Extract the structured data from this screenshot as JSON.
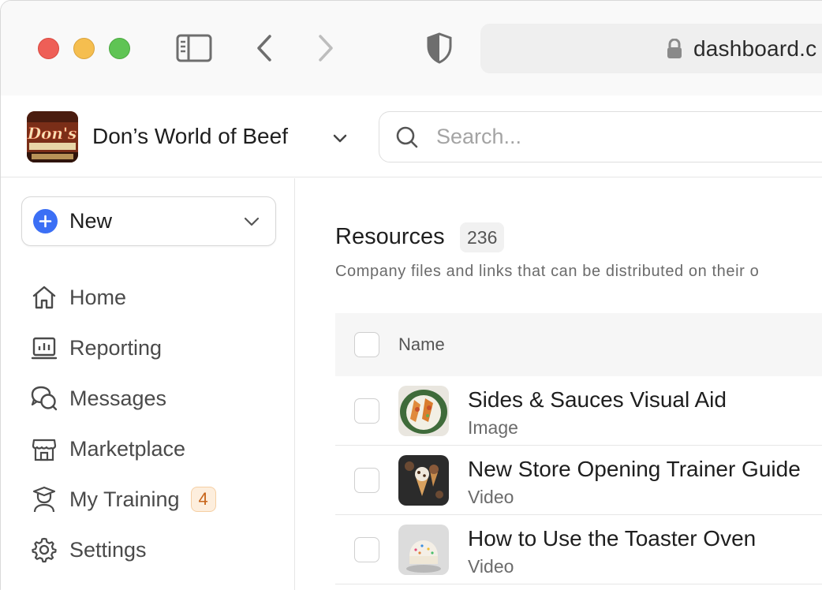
{
  "browser": {
    "url": "dashboard.c",
    "icons": [
      "sidebar-toggle-icon",
      "back-arrow-icon",
      "forward-arrow-icon",
      "shield-icon",
      "lock-icon"
    ]
  },
  "header": {
    "org_name": "Don’s World of Beef",
    "logo_text": "Don's",
    "search_placeholder": "Search..."
  },
  "sidebar": {
    "new_label": "New",
    "items": [
      {
        "label": "Home",
        "icon": "home-icon"
      },
      {
        "label": "Reporting",
        "icon": "reporting-icon"
      },
      {
        "label": "Messages",
        "icon": "messages-icon"
      },
      {
        "label": "Marketplace",
        "icon": "marketplace-icon"
      },
      {
        "label": "My Training",
        "icon": "training-icon",
        "badge": "4"
      },
      {
        "label": "Settings",
        "icon": "gear-icon"
      }
    ]
  },
  "main": {
    "title": "Resources",
    "count": "236",
    "description": "Company files and links that can be distributed on their o",
    "table": {
      "header": "Name",
      "rows": [
        {
          "title": "Sides & Sauces Visual Aid",
          "type": "Image"
        },
        {
          "title": "New Store Opening Trainer Guide",
          "type": "Video"
        },
        {
          "title": "How to Use the Toaster Oven",
          "type": "Video"
        }
      ]
    }
  },
  "colors": {
    "accent": "#3b6ff5",
    "badge_bg": "#fdeedd",
    "badge_text": "#c7651b"
  }
}
